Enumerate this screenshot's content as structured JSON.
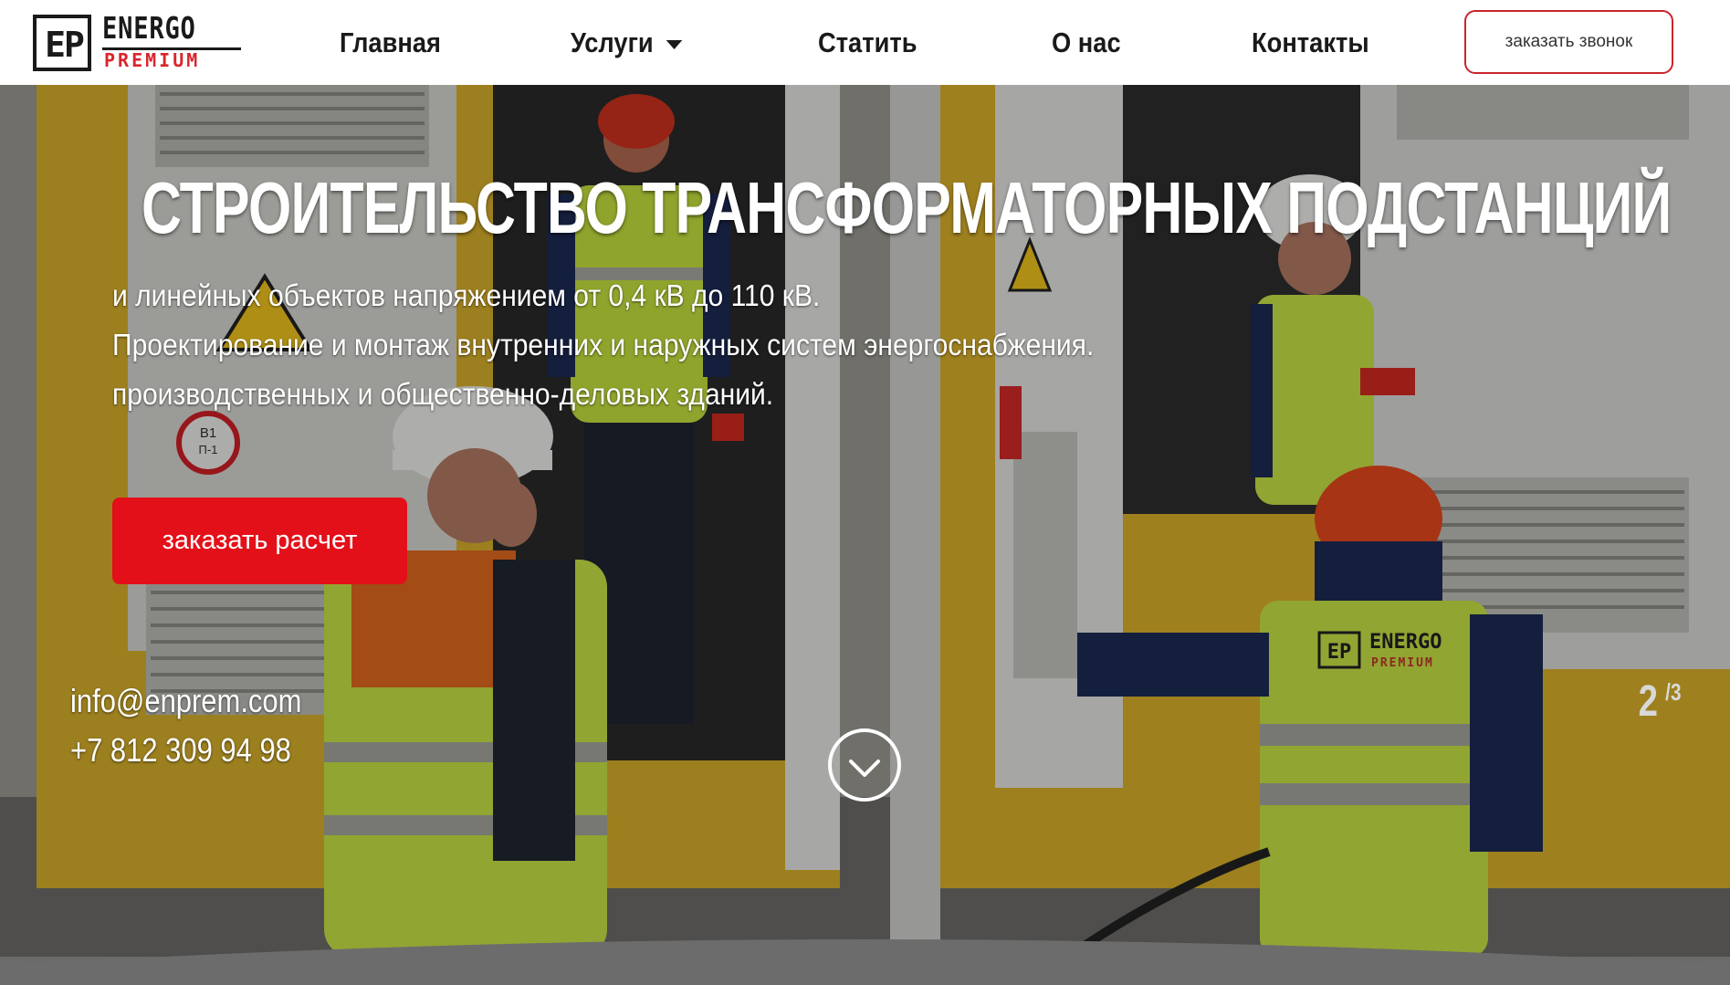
{
  "header": {
    "logo": {
      "word1": "ENERGO",
      "word2": "PREMIUM",
      "mark": "EP"
    },
    "nav": [
      {
        "label": "Главная"
      },
      {
        "label": "Услуги",
        "has_dropdown": true,
        "icon": "chevron-down-icon"
      },
      {
        "label": "Статить"
      },
      {
        "label": "О нас"
      },
      {
        "label": "Контакты"
      }
    ],
    "callback_button": "заказать звонок"
  },
  "hero": {
    "title": "СТРОИТЕЛЬСТВО ТРАНСФОРМАТОРНЫХ ПОДСТАНЦИЙ",
    "lines": [
      "и линейных объектов напряжением от 0,4 кВ до 110 кВ.",
      "Проектирование и монтаж внутренних и наружных систем энергоснабжения.",
      "производственных и общественно-деловых зданий."
    ],
    "cta_button": "заказать расчет",
    "email": "info@enprem.com",
    "phone": "+7 812 309 94 98",
    "slide_current": "2",
    "slide_total": "/3",
    "scroll_icon": "chevron-down-circle-icon",
    "background_image_labels": {
      "sign_b1": "В1",
      "sign_p1": "П-1",
      "vest_brand": "ENERGO",
      "vest_brand2": "PREMIUM",
      "vest_mark": "EP"
    }
  },
  "colors": {
    "accent_red": "#e3101a",
    "logo_red": "#d9262e",
    "nav_text": "#1a1a1a",
    "hero_yellow": "#e2b52a",
    "vest_green": "#c9e84a"
  }
}
